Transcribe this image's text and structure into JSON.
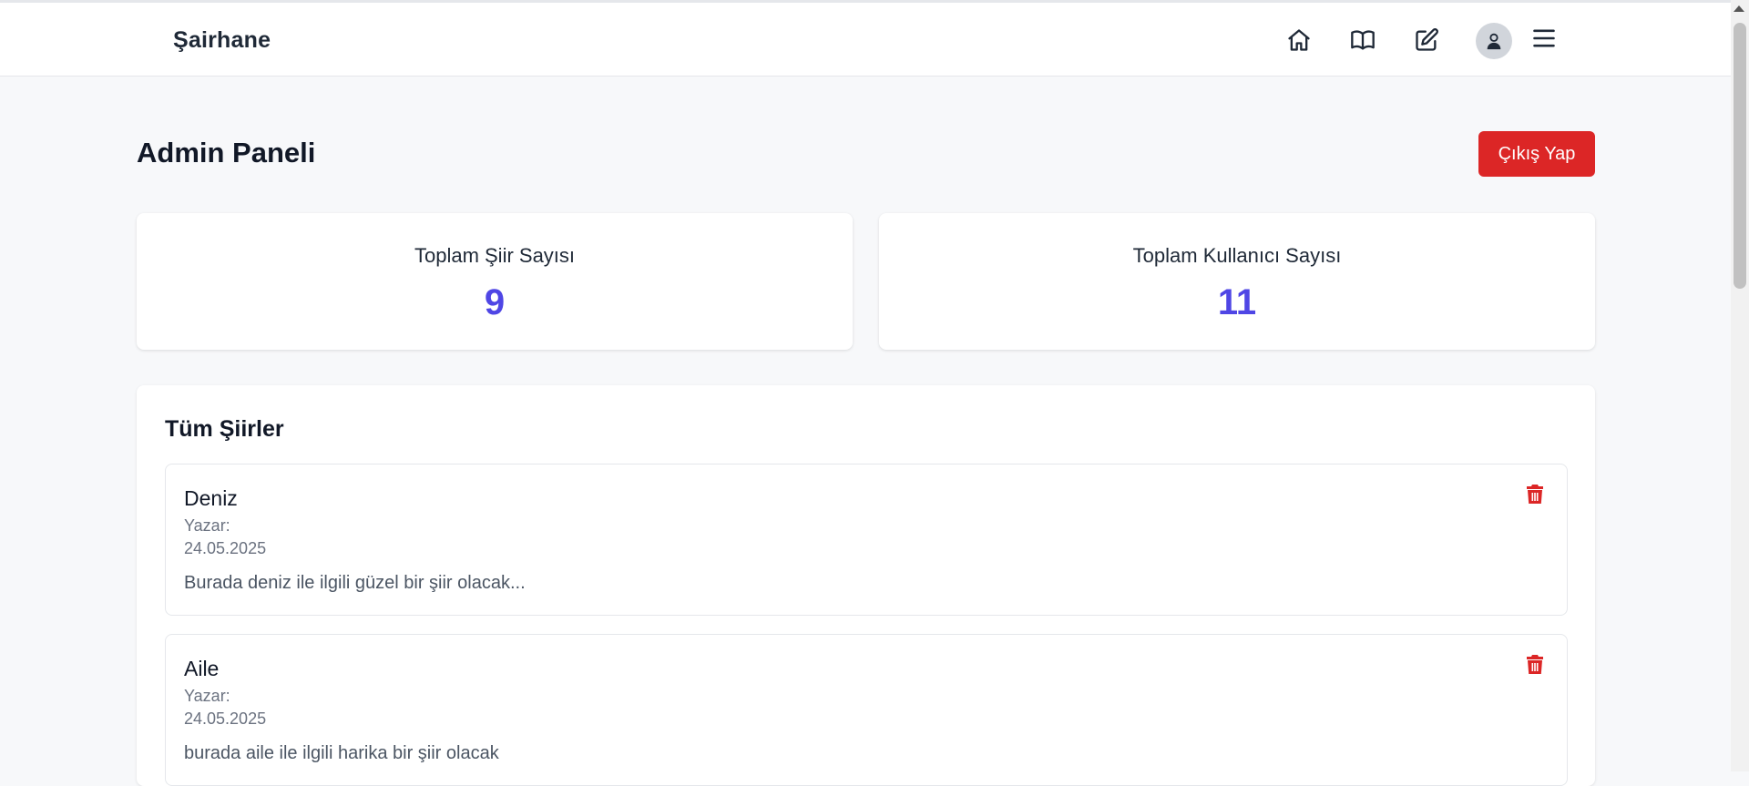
{
  "navbar": {
    "brand": "Şairhane",
    "icons": [
      "home-icon",
      "book-open-icon",
      "edit-icon",
      "user-avatar-icon",
      "menu-icon"
    ]
  },
  "header": {
    "title": "Admin Paneli",
    "logout_label": "Çıkış Yap"
  },
  "stats": [
    {
      "label": "Toplam Şiir Sayısı",
      "value": "9"
    },
    {
      "label": "Toplam Kullanıcı Sayısı",
      "value": "11"
    }
  ],
  "poems_section": {
    "title": "Tüm Şiirler",
    "items": [
      {
        "title": "Deniz",
        "author": "Yazar:",
        "date": "24.05.2025",
        "excerpt": "Burada deniz ile ilgili güzel bir şiir olacak..."
      },
      {
        "title": "Aile",
        "author": "Yazar:",
        "date": "24.05.2025",
        "excerpt": "burada aile ile ilgili harika bir şiir olacak"
      }
    ]
  },
  "colors": {
    "accent": "#4f46e5",
    "danger": "#dc2626",
    "background": "#f7f8fa"
  }
}
